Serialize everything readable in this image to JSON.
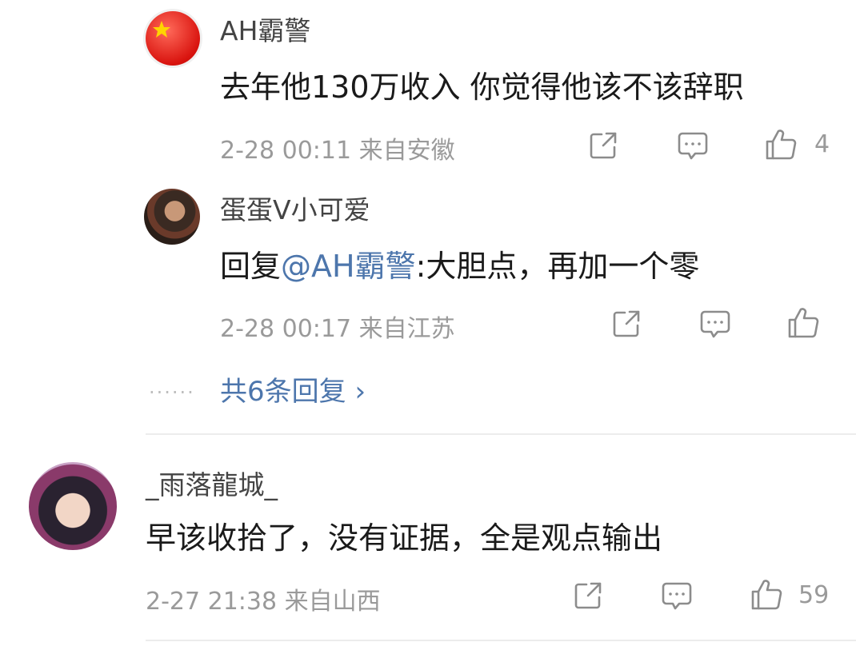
{
  "comment1": {
    "username": "AH霸警",
    "text": "去年他130万收入 你觉得他该不该辞职",
    "meta": "2-28 00:11 来自安徽",
    "likes": "4"
  },
  "reply1": {
    "username": "蛋蛋V小可爱",
    "reply_prefix": "回复",
    "mention": "@AH霸警",
    "text": ":大胆点，再加一个零",
    "meta": "2-28 00:17 来自江苏"
  },
  "more_replies": {
    "dots": "......",
    "label": "共6条回复 ›"
  },
  "comment2": {
    "username": "_雨落龍城_",
    "text": "早该收拾了，没有证据，全是观点输出",
    "meta": "2-27 21:38 来自山西",
    "likes": "59"
  },
  "icons": {
    "share": "share-icon",
    "comment": "comment-icon",
    "like": "thumbs-up-icon"
  },
  "colors": {
    "link": "#4d76ac",
    "meta": "#9a9a9a",
    "text": "#1a1a1a"
  }
}
